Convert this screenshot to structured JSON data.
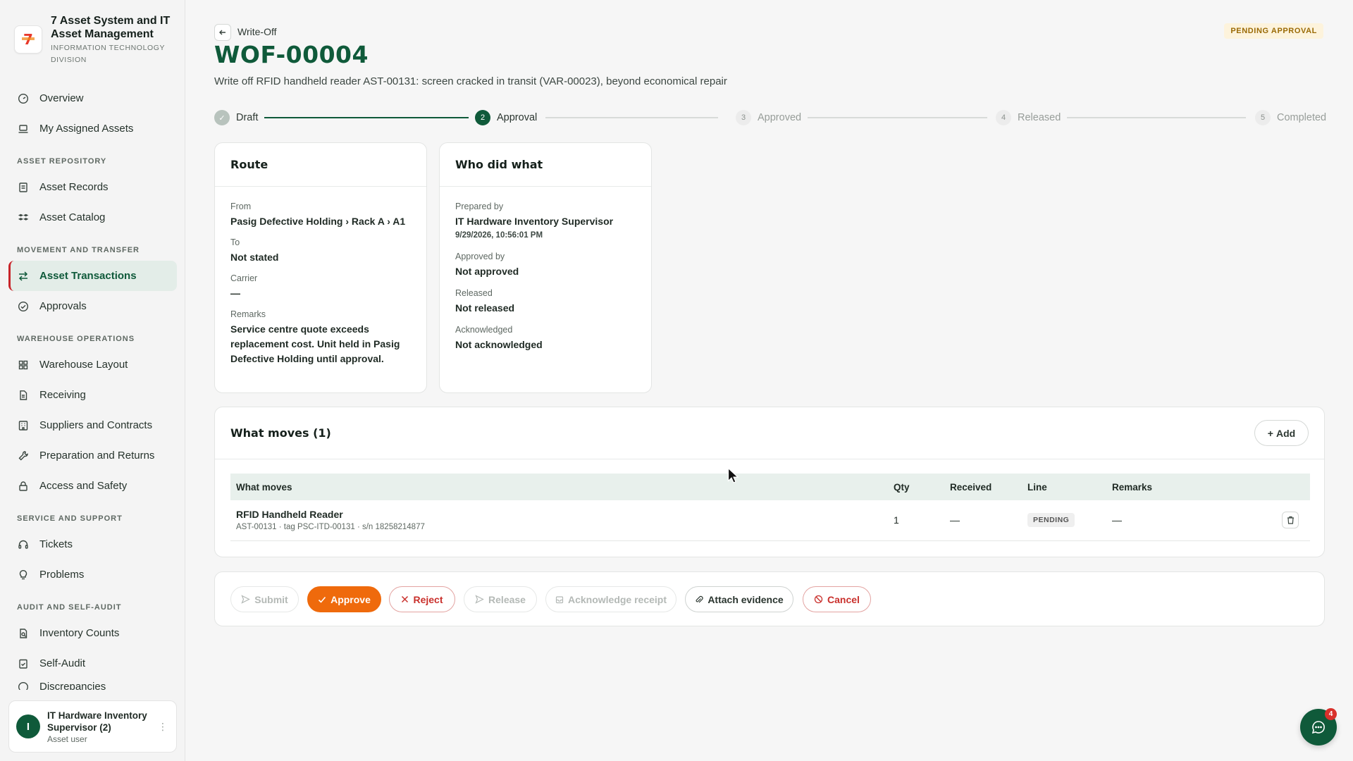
{
  "app": {
    "title": "7 Asset System and IT Asset Management",
    "subtitle": "INFORMATION TECHNOLOGY DIVISION",
    "logo_text": "7"
  },
  "nav": {
    "overview": "Overview",
    "my_assets": "My Assigned Assets",
    "sec_repo": "ASSET REPOSITORY",
    "asset_records": "Asset Records",
    "asset_catalog": "Asset Catalog",
    "sec_move": "MOVEMENT AND TRANSFER",
    "asset_transactions": "Asset Transactions",
    "approvals": "Approvals",
    "sec_wh": "WAREHOUSE OPERATIONS",
    "warehouse_layout": "Warehouse Layout",
    "receiving": "Receiving",
    "suppliers": "Suppliers and Contracts",
    "prep_returns": "Preparation and Returns",
    "access_safety": "Access and Safety",
    "sec_service": "SERVICE AND SUPPORT",
    "tickets": "Tickets",
    "problems": "Problems",
    "sec_audit": "AUDIT AND SELF-AUDIT",
    "inventory_counts": "Inventory Counts",
    "self_audit": "Self-Audit",
    "discrepancies": "Discrepancies"
  },
  "user": {
    "initial": "I",
    "name": "IT Hardware Inventory Supervisor (2)",
    "role": "Asset user"
  },
  "header": {
    "crumb": "Write-Off",
    "doc_id": "WOF-00004",
    "description": "Write off RFID handheld reader AST-00131: screen cracked in transit (VAR-00023), beyond economical repair",
    "status": "PENDING APPROVAL"
  },
  "stepper": [
    {
      "num": "✓",
      "label": "Draft",
      "state": "done"
    },
    {
      "num": "2",
      "label": "Approval",
      "state": "current"
    },
    {
      "num": "3",
      "label": "Approved",
      "state": "todo"
    },
    {
      "num": "4",
      "label": "Released",
      "state": "todo"
    },
    {
      "num": "5",
      "label": "Completed",
      "state": "todo"
    }
  ],
  "route": {
    "title": "Route",
    "from_label": "From",
    "from_value": "Pasig Defective Holding › Rack A › A1",
    "to_label": "To",
    "to_value": "Not stated",
    "carrier_label": "Carrier",
    "carrier_value": "—",
    "remarks_label": "Remarks",
    "remarks_value": "Service centre quote exceeds replacement cost. Unit held in Pasig Defective Holding until approval."
  },
  "who": {
    "title": "Who did what",
    "prepared_label": "Prepared by",
    "prepared_value": "IT Hardware Inventory Supervisor",
    "prepared_time": "9/29/2026, 10:56:01 PM",
    "approved_label": "Approved by",
    "approved_value": "Not approved",
    "released_label": "Released",
    "released_value": "Not released",
    "ack_label": "Acknowledged",
    "ack_value": "Not acknowledged"
  },
  "moves": {
    "title": "What moves (1)",
    "add_label": "Add",
    "columns": {
      "what": "What moves",
      "qty": "Qty",
      "received": "Received",
      "line": "Line",
      "remarks": "Remarks"
    },
    "rows": [
      {
        "name": "RFID Handheld Reader",
        "sub": "AST-00131 · tag PSC-ITD-00131 · s/n 18258214877",
        "qty": "1",
        "received": "—",
        "line": "PENDING",
        "remarks": "—"
      }
    ]
  },
  "actions": {
    "submit": "Submit",
    "approve": "Approve",
    "reject": "Reject",
    "release": "Release",
    "acknowledge": "Acknowledge receipt",
    "attach": "Attach evidence",
    "cancel": "Cancel"
  },
  "chat": {
    "badge": "4"
  },
  "colors": {
    "brand_green": "#0f5a3a",
    "accent_orange": "#ef6a0c",
    "danger_red": "#c9302c",
    "pending_amber": "#9a6a05"
  }
}
